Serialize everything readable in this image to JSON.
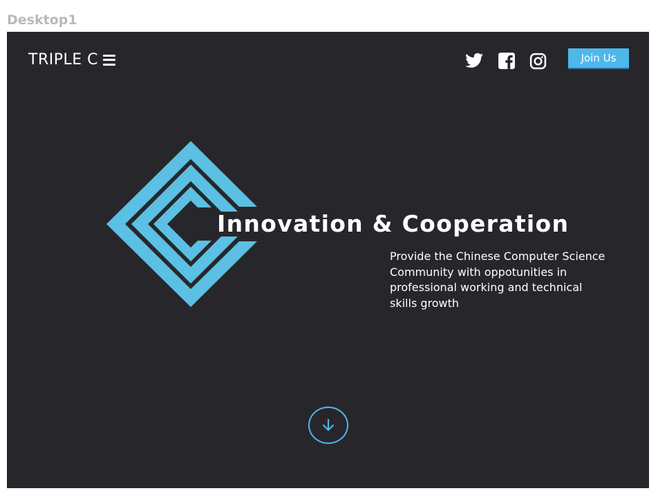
{
  "artboard": {
    "label": "Desktop1"
  },
  "nav": {
    "brand": "TRIPLE C",
    "menu_icon": "hamburger-icon",
    "social": [
      {
        "name": "twitter-icon"
      },
      {
        "name": "facebook-icon"
      },
      {
        "name": "instagram-icon"
      }
    ],
    "join_label": "Join Us"
  },
  "hero": {
    "logo_icon": "triple-c-logo",
    "headline": "Innovation & Cooperation",
    "subline": "Provide the Chinese Computer Science Community with oppotunities in professional working and technical skills growth",
    "scroll_icon": "arrow-down-icon"
  },
  "colors": {
    "background": "#27272b",
    "accent": "#4eb8eb",
    "logo": "#5bc0e3",
    "text": "#ffffff",
    "label": "#b9b9b9"
  }
}
